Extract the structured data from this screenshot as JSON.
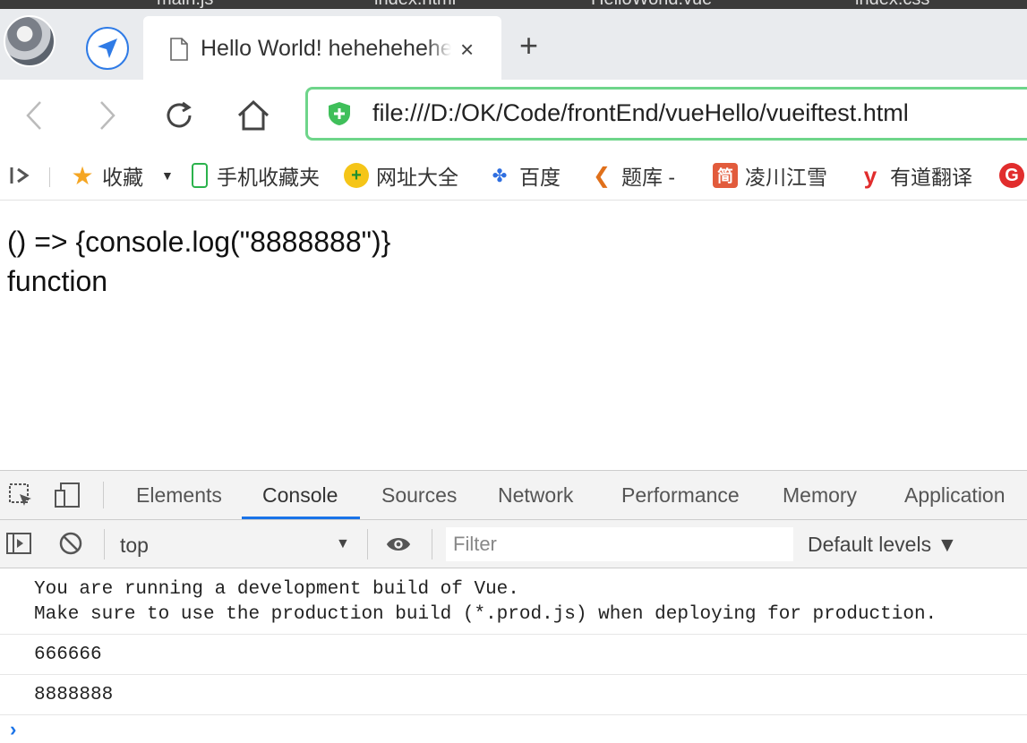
{
  "taskbar": {
    "items": [
      "main.js",
      "index.html",
      "HelloWorld.vue",
      "index.css"
    ]
  },
  "tab": {
    "title": "Hello World! hehehehehe",
    "close_glyph": "×",
    "new_tab_glyph": "+"
  },
  "toolbar": {
    "back_glyph": "‹",
    "forward_glyph": "›"
  },
  "address": {
    "url": "file:///D:/OK/Code/frontEnd/vueHello/vueiftest.html"
  },
  "bookmarks": {
    "items": [
      {
        "label": "收藏",
        "icon": "star-icon"
      },
      {
        "label": "手机收藏夹",
        "icon": "phone-icon"
      },
      {
        "label": "网址大全",
        "icon": "plus-circle-icon"
      },
      {
        "label": "百度",
        "icon": "paw-icon"
      },
      {
        "label": "题库 -",
        "icon": "c-logo-icon"
      },
      {
        "label": "凌川江雪",
        "icon": "jian-icon"
      },
      {
        "label": "有道翻译",
        "icon": "youdao-icon"
      }
    ]
  },
  "page": {
    "line1": "() => {console.log(\"8888888\")}",
    "line2": "function"
  },
  "devtools": {
    "tabs": [
      "Elements",
      "Console",
      "Sources",
      "Network",
      "Performance",
      "Memory",
      "Application"
    ],
    "active_tab": "Console",
    "context": "top",
    "filter_placeholder": "Filter",
    "levels": "Default levels ▼",
    "messages": [
      "You are running a development build of Vue.\nMake sure to use the production build (*.prod.js) when deploying for production.",
      "666666",
      "8888888"
    ],
    "prompt": "›"
  },
  "colors": {
    "accent": "#1a73e8",
    "url_border": "#6ed58a"
  }
}
